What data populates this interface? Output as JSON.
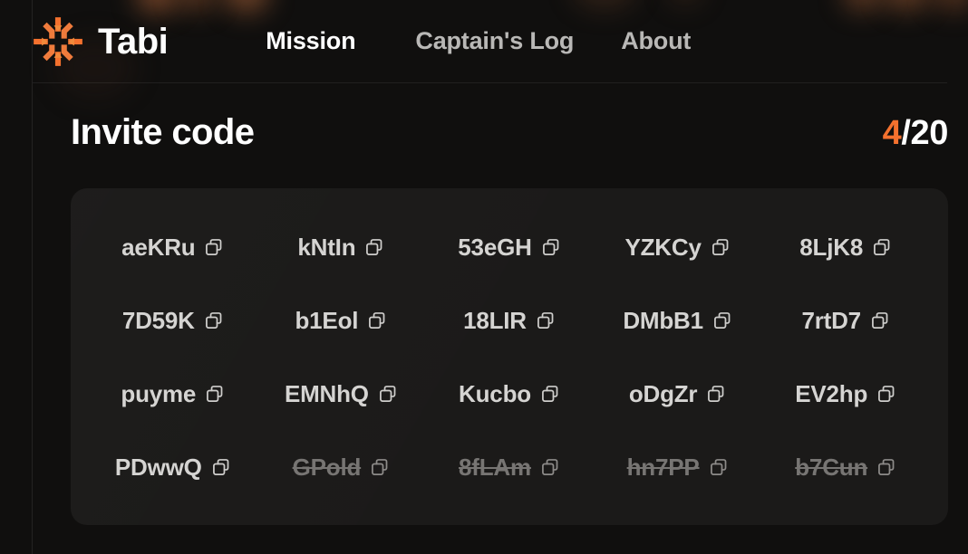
{
  "brand": {
    "name": "Tabi",
    "logo_icon": "tabi-starburst-logo",
    "accent_color": "#f4712e"
  },
  "nav": {
    "items": [
      {
        "label": "Mission",
        "active": true
      },
      {
        "label": "Captain's Log",
        "active": false
      },
      {
        "label": "About",
        "active": false
      }
    ]
  },
  "invite_section": {
    "title": "Invite code",
    "counter": {
      "used": "4",
      "separator": "/",
      "total": "20"
    },
    "copy_icon": "copy-icon",
    "codes": [
      {
        "code": "aeKRu",
        "used": false
      },
      {
        "code": "kNtIn",
        "used": false
      },
      {
        "code": "53eGH",
        "used": false
      },
      {
        "code": "YZKCy",
        "used": false
      },
      {
        "code": "8LjK8",
        "used": false
      },
      {
        "code": "7D59K",
        "used": false
      },
      {
        "code": "b1Eol",
        "used": false
      },
      {
        "code": "18LIR",
        "used": false
      },
      {
        "code": "DMbB1",
        "used": false
      },
      {
        "code": "7rtD7",
        "used": false
      },
      {
        "code": "puyme",
        "used": false
      },
      {
        "code": "EMNhQ",
        "used": false
      },
      {
        "code": "Kucbo",
        "used": false
      },
      {
        "code": "oDgZr",
        "used": false
      },
      {
        "code": "EV2hp",
        "used": false
      },
      {
        "code": "PDwwQ",
        "used": false
      },
      {
        "code": "GPold",
        "used": true
      },
      {
        "code": "8fLAm",
        "used": true
      },
      {
        "code": "hn7PP",
        "used": true
      },
      {
        "code": "b7Cun",
        "used": true
      }
    ]
  }
}
